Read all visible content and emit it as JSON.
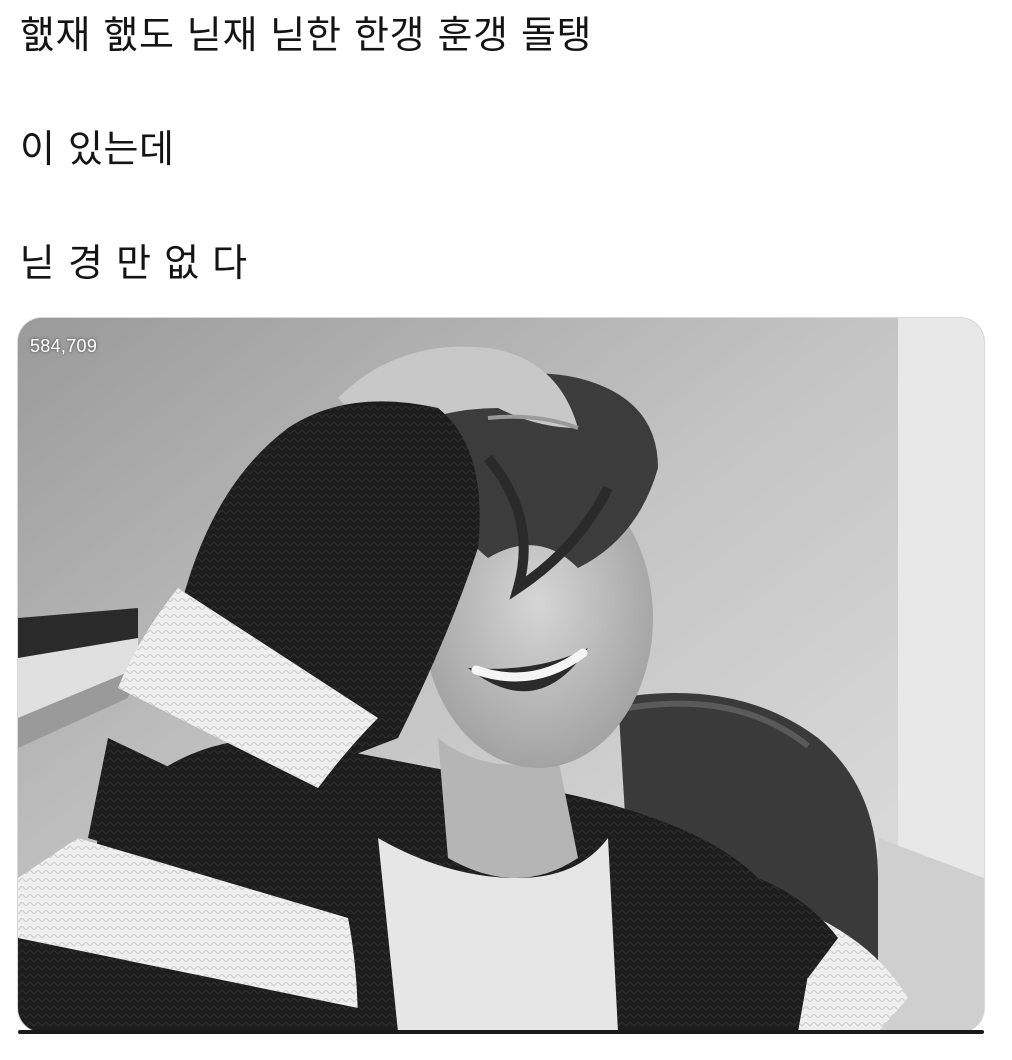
{
  "post": {
    "lines": [
      "햀재 햀도 닏재 닏한 한갱 훈갱 돌탱",
      "이 있는데",
      "닏 경 만 없 다"
    ]
  },
  "media": {
    "view_count": "584,709",
    "kind": "black-and-white photo",
    "colors": {
      "wall": "#d8d8d8",
      "sweater_dark": "#1c1c1c",
      "sweater_light": "#f2f2f2",
      "skin": "#bdbdbd"
    }
  }
}
